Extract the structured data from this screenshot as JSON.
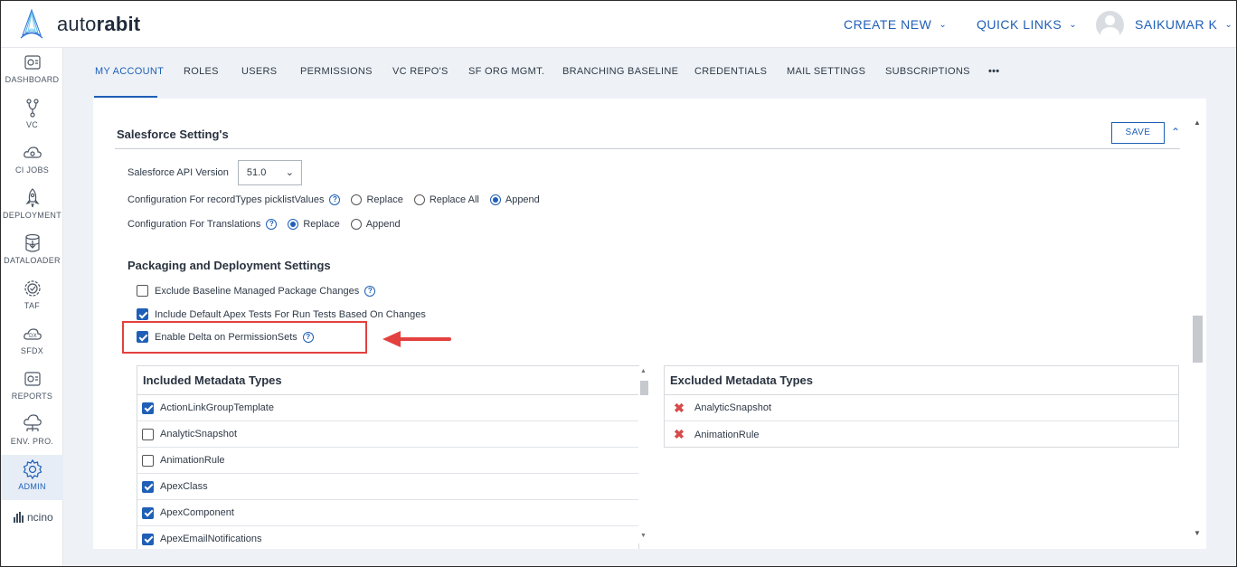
{
  "header": {
    "brand_prefix": "auto",
    "brand_bold": "rabit",
    "create_new": "CREATE NEW",
    "quick_links": "QUICK LINKS",
    "user_name": "SAIKUMAR K"
  },
  "sidebar": {
    "items": [
      {
        "label": "DASHBOARD",
        "icon": "dashboard-icon"
      },
      {
        "label": "VC",
        "icon": "branch-icon"
      },
      {
        "label": "CI JOBS",
        "icon": "cloud-gear-icon"
      },
      {
        "label": "DEPLOYMENT",
        "icon": "rocket-icon"
      },
      {
        "label": "DATALOADER",
        "icon": "database-icon"
      },
      {
        "label": "TAF",
        "icon": "gear-check-icon"
      },
      {
        "label": "SFDX",
        "icon": "dx-cloud-icon"
      },
      {
        "label": "REPORTS",
        "icon": "reports-icon"
      },
      {
        "label": "ENV. PRO.",
        "icon": "cloud-network-icon"
      },
      {
        "label": "ADMIN",
        "icon": "gear-icon"
      }
    ],
    "footer_brand": "ncino"
  },
  "tabs": [
    "MY ACCOUNT",
    "ROLES",
    "USERS",
    "PERMISSIONS",
    "VC REPO'S",
    "SF ORG MGMT.",
    "BRANCHING BASELINE",
    "CREDENTIALS",
    "MAIL SETTINGS",
    "SUBSCRIPTIONS",
    "•••"
  ],
  "salesforce": {
    "title": "Salesforce Setting's",
    "save_label": "SAVE",
    "api_version_label": "Salesforce API Version",
    "api_version_value": "51.0",
    "record_types_label": "Configuration For recordTypes picklistValues",
    "record_types_options": [
      "Replace",
      "Replace All",
      "Append"
    ],
    "record_types_selected": "Append",
    "translations_label": "Configuration For Translations",
    "translations_options": [
      "Replace",
      "Append"
    ],
    "translations_selected": "Replace"
  },
  "packaging": {
    "title": "Packaging and Deployment Settings",
    "exclude_baseline": {
      "label": "Exclude Baseline Managed Package Changes",
      "checked": false
    },
    "include_default_apex": {
      "label": "Include Default Apex Tests For Run Tests Based On Changes",
      "checked": true
    },
    "enable_delta": {
      "label": "Enable Delta on PermissionSets",
      "checked": true
    }
  },
  "included_metadata": {
    "title": "Included Metadata Types",
    "items": [
      {
        "label": "ActionLinkGroupTemplate",
        "checked": true
      },
      {
        "label": "AnalyticSnapshot",
        "checked": false
      },
      {
        "label": "AnimationRule",
        "checked": false
      },
      {
        "label": "ApexClass",
        "checked": true
      },
      {
        "label": "ApexComponent",
        "checked": true
      },
      {
        "label": "ApexEmailNotifications",
        "checked": true
      }
    ]
  },
  "excluded_metadata": {
    "title": "Excluded Metadata Types",
    "items": [
      "AnalyticSnapshot",
      "AnimationRule"
    ]
  },
  "colors": {
    "accent": "#1f5fb7",
    "highlight": "#e3413f",
    "remove": "#d94a4a"
  }
}
